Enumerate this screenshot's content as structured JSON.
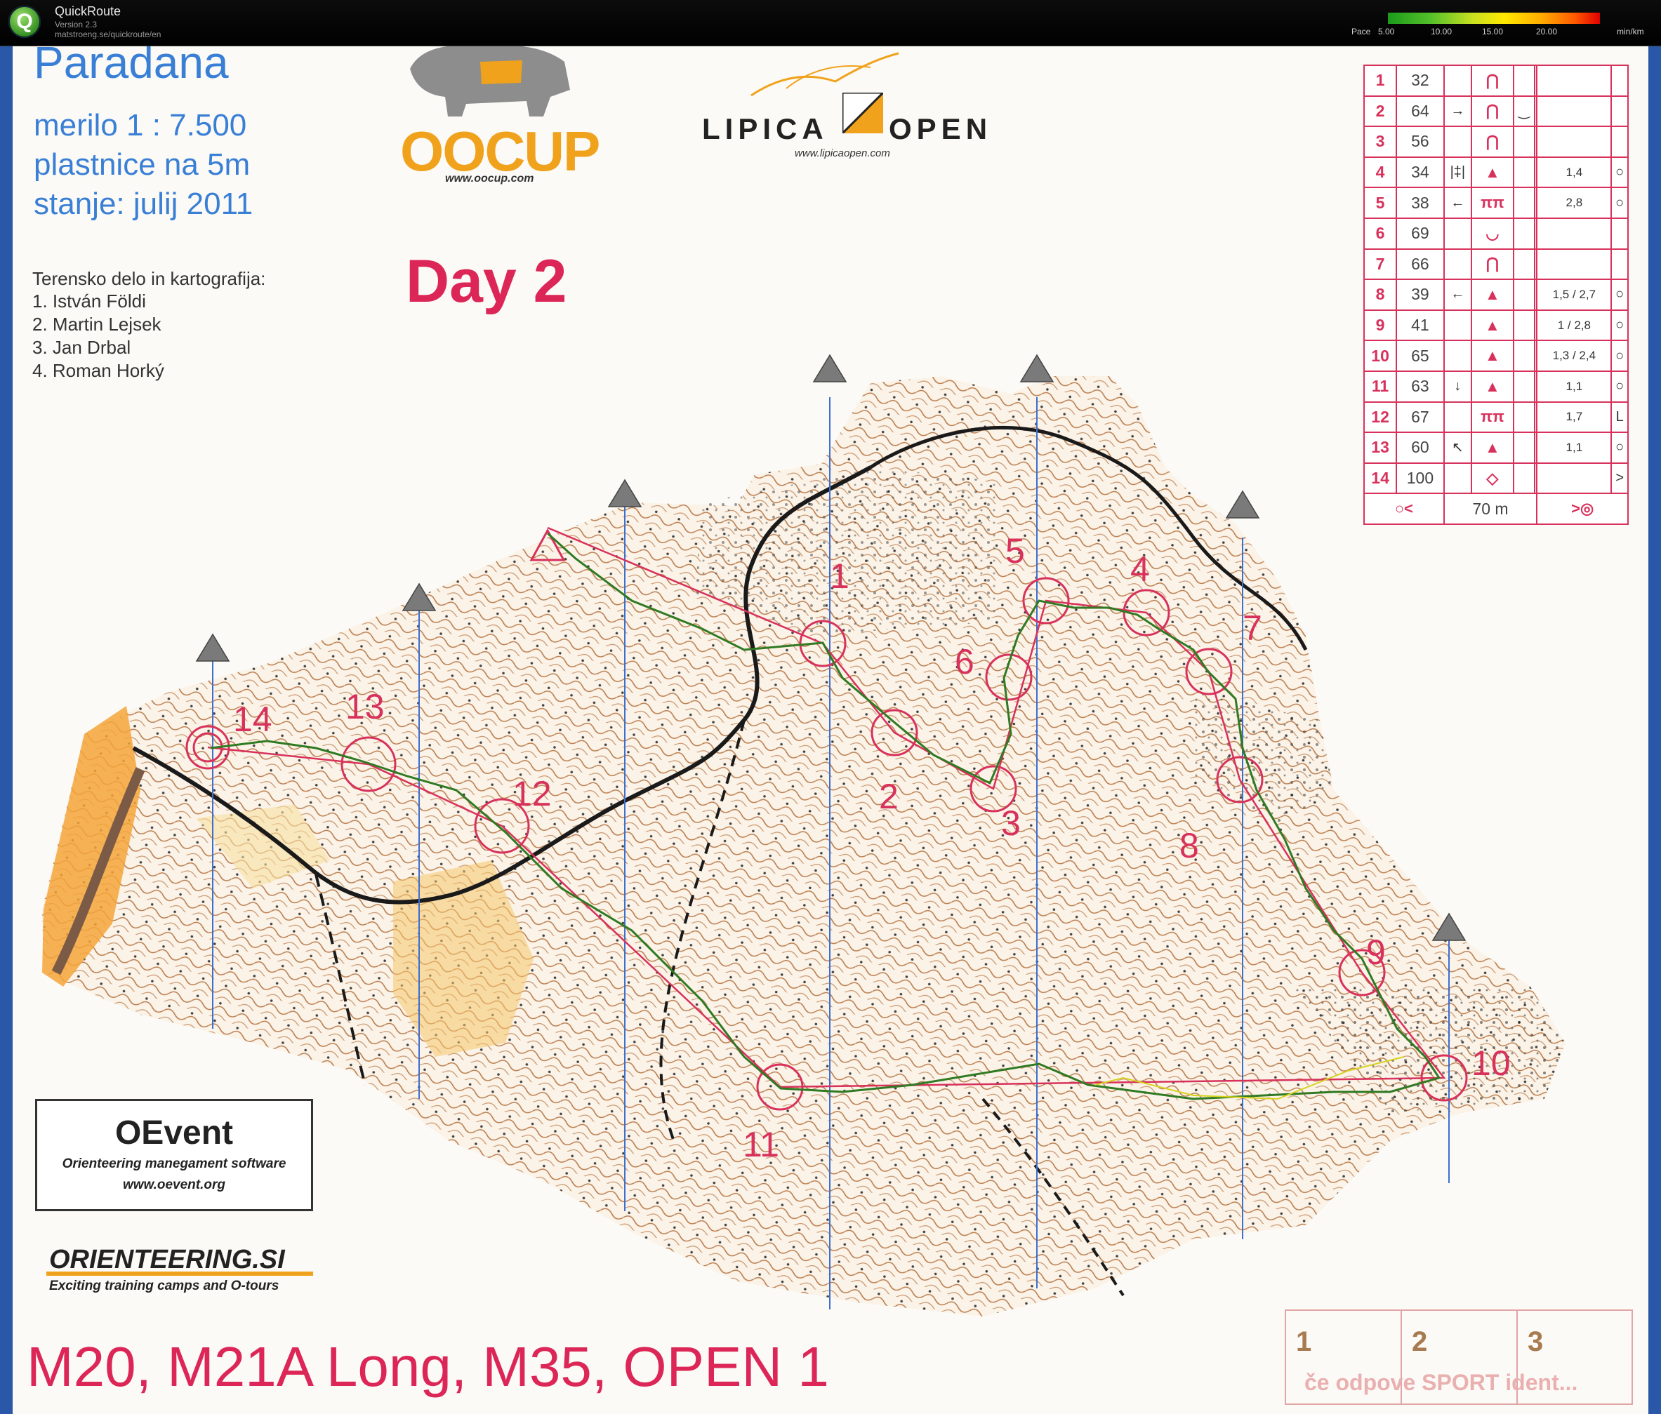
{
  "app": {
    "title": "QuickRoute",
    "version": "Version 2.3",
    "url": "matstroeng.se/quickroute/en",
    "logo_letter": "Q"
  },
  "pace_legend": {
    "label": "Pace",
    "ticks": [
      "5.00",
      "10.00",
      "15.00",
      "20.00"
    ],
    "unit": "min/km"
  },
  "map_header": {
    "title": "Paradana",
    "scale": "merilo 1 : 7.500",
    "contours": "plastnice na 5m",
    "state": "stanje: julij 2011",
    "credits_title": "Terensko delo in kartografija:",
    "credits": [
      "1. István Földi",
      "2. Martin Lejsek",
      "3. Jan Drbal",
      "4. Roman Horký"
    ],
    "day": "Day 2"
  },
  "sponsors": {
    "oocup_word": "OOCUP",
    "oocup_url": "www.oocup.com",
    "lipica_left": "LIPICA",
    "lipica_right": "OPEN",
    "lipica_url": "www.lipicaopen.com",
    "oevent_title": "OEvent",
    "oevent_sub": "Orienteering manegament software",
    "oevent_url": "www.oevent.org",
    "orient_title": "ORIENTEERING.SI",
    "orient_sub": "Exciting training camps and O-tours"
  },
  "control_descriptions": [
    {
      "n": "1",
      "code": "32",
      "c": "",
      "d": "⋂",
      "e": "",
      "f": "",
      "g": ""
    },
    {
      "n": "2",
      "code": "64",
      "c": "→",
      "d": "⋂",
      "e": "‿",
      "f": "",
      "g": ""
    },
    {
      "n": "3",
      "code": "56",
      "c": "",
      "d": "⋂",
      "e": "",
      "f": "",
      "g": ""
    },
    {
      "n": "4",
      "code": "34",
      "c": "|‡|",
      "d": "▲",
      "e": "",
      "f": "1,4",
      "g": "○"
    },
    {
      "n": "5",
      "code": "38",
      "c": "←",
      "d": "ππ",
      "e": "",
      "f": "2,8",
      "g": "○"
    },
    {
      "n": "6",
      "code": "69",
      "c": "",
      "d": "◡",
      "e": "",
      "f": "",
      "g": ""
    },
    {
      "n": "7",
      "code": "66",
      "c": "",
      "d": "⋂",
      "e": "",
      "f": "",
      "g": ""
    },
    {
      "n": "8",
      "code": "39",
      "c": "←",
      "d": "▲",
      "e": "",
      "f": "1,5 / 2,7",
      "g": "○"
    },
    {
      "n": "9",
      "code": "41",
      "c": "",
      "d": "▲",
      "e": "",
      "f": "1 / 2,8",
      "g": "○"
    },
    {
      "n": "10",
      "code": "65",
      "c": "",
      "d": "▲",
      "e": "",
      "f": "1,3 / 2,4",
      "g": "○"
    },
    {
      "n": "11",
      "code": "63",
      "c": "↓",
      "d": "▲",
      "e": "",
      "f": "1,1",
      "g": "○"
    },
    {
      "n": "12",
      "code": "67",
      "c": "",
      "d": "ππ",
      "e": "",
      "f": "1,7",
      "g": "L"
    },
    {
      "n": "13",
      "code": "60",
      "c": "↖",
      "d": "▲",
      "e": "",
      "f": "1,1",
      "g": "○"
    },
    {
      "n": "14",
      "code": "100",
      "c": "",
      "d": "◇",
      "e": "",
      "f": "",
      "g": ">"
    }
  ],
  "finish_row": {
    "left": "○<",
    "label": "70 m",
    "right": ">◎"
  },
  "control_labels": [
    "1",
    "2",
    "3",
    "4",
    "5",
    "6",
    "7",
    "8",
    "9",
    "10",
    "11",
    "12",
    "13",
    "14"
  ],
  "class_label": "M20, M21A Long, M35, OPEN 1",
  "signature": {
    "cells": [
      "1",
      "2",
      "3"
    ],
    "text": "če odpove SPORT ident..."
  },
  "colors": {
    "course": "#d8315b",
    "route": "#2f7a22",
    "route_alt": "#d7d21e",
    "contours": "#b06a35",
    "roads": "#1a1a1a",
    "open_land": "#f5a53a",
    "north_lines": "#3c6fd0"
  }
}
